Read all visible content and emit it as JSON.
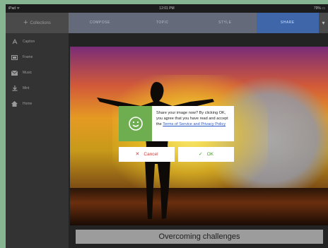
{
  "status_bar": {
    "carrier": "iPad ᯤ",
    "time": "12:01 PM",
    "battery": "79% ▭"
  },
  "header": {
    "back_label": "Collections",
    "tabs": [
      {
        "label": "COMPOSE",
        "active": false
      },
      {
        "label": "TOPIC",
        "active": false
      },
      {
        "label": "STYLE",
        "active": false
      },
      {
        "label": "SHARE",
        "active": true
      }
    ],
    "more_label": "▾"
  },
  "sidebar": {
    "items": [
      {
        "label": "Caption",
        "icon": "text-icon"
      },
      {
        "label": "Frame",
        "icon": "frame-icon"
      },
      {
        "label": "Music",
        "icon": "mail-icon"
      },
      {
        "label": "Mint",
        "icon": "download-icon"
      },
      {
        "label": "Home",
        "icon": "home-icon"
      }
    ]
  },
  "image": {
    "caption": "Overcoming challenges"
  },
  "dialog": {
    "icon": "smiley-icon",
    "message_before": "Share your image now? By clicking OK, you agree that you have read and accept the ",
    "terms_link": "Terms of Service and Privacy Policy",
    "cancel_label": "Cancel",
    "ok_label": "OK"
  },
  "colors": {
    "accent_tab": "#3e66a8",
    "dialog_icon_bg": "#6fad51",
    "cancel": "#cf3b3b",
    "ok": "#4c9a36",
    "link": "#2a56c6"
  }
}
